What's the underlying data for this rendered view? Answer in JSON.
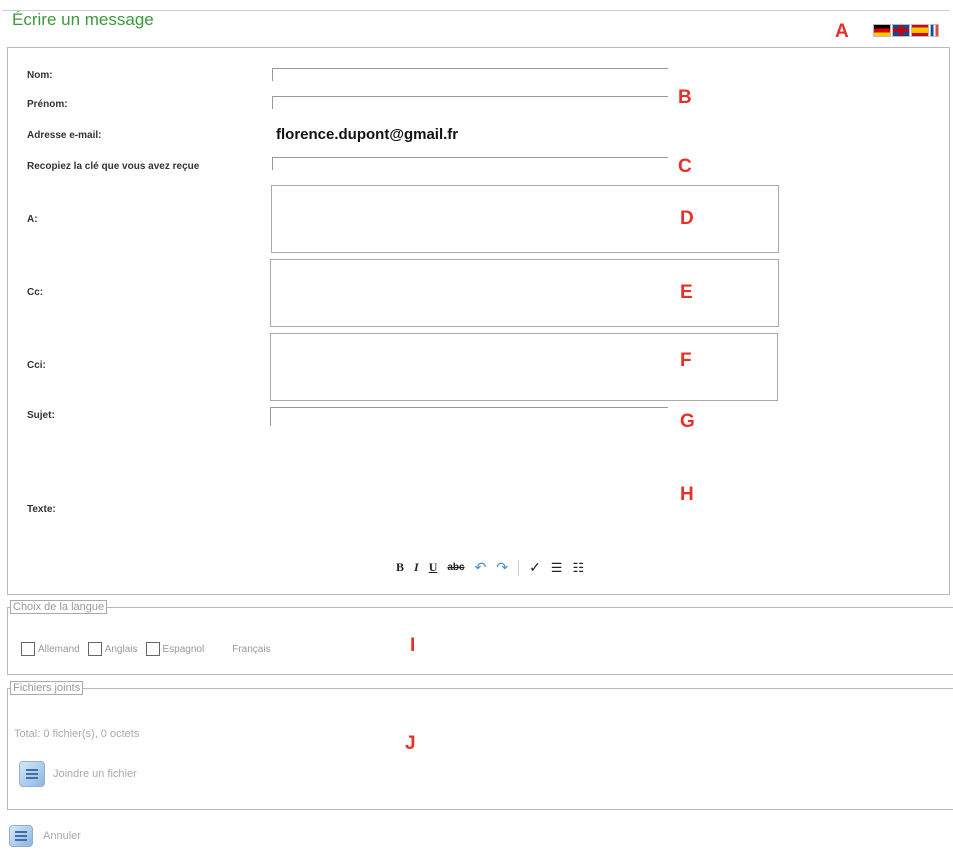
{
  "header": {
    "title": "Écrire un message"
  },
  "language_flags": [
    "german-flag",
    "uk-flag",
    "spanish-flag",
    "french-flag"
  ],
  "form": {
    "labels": {
      "nom": "Nom:",
      "prenom": "Prénom:",
      "email": "Adresse e-mail:",
      "cle": "Recopiez la clé que vous avez reçue",
      "a": "A:",
      "cc": "Cc:",
      "cci": "Cci:",
      "sujet": "Sujet:",
      "texte": "Texte:"
    },
    "values": {
      "email": "florence.dupont@gmail.fr"
    }
  },
  "markers": {
    "A": "A",
    "B": "B",
    "C": "C",
    "D": "D",
    "E": "E",
    "F": "F",
    "G": "G",
    "H": "H",
    "I": "I",
    "J": "J"
  },
  "toolbar": {
    "bold": "B",
    "italic": "I",
    "underline": "U",
    "strike": "abc",
    "undo": "↶",
    "redo": "↷",
    "spellcheck": "✓",
    "bullets": "☰",
    "numbered": "☷"
  },
  "language_choice": {
    "legend": "Choix de la langue",
    "options": [
      "Allemand",
      "Anglais",
      "Espagnol",
      "Français"
    ]
  },
  "attachments": {
    "legend": "Fichiers joints",
    "total": "Total: 0 fichier(s), 0 octets",
    "add_label": "Joindre un fichier"
  },
  "footer": {
    "cancel_label": "Annuler"
  },
  "colors": {
    "title": "#3a9a3a",
    "marker": "#e8302a",
    "accent_blue": "#3d8fd8"
  }
}
